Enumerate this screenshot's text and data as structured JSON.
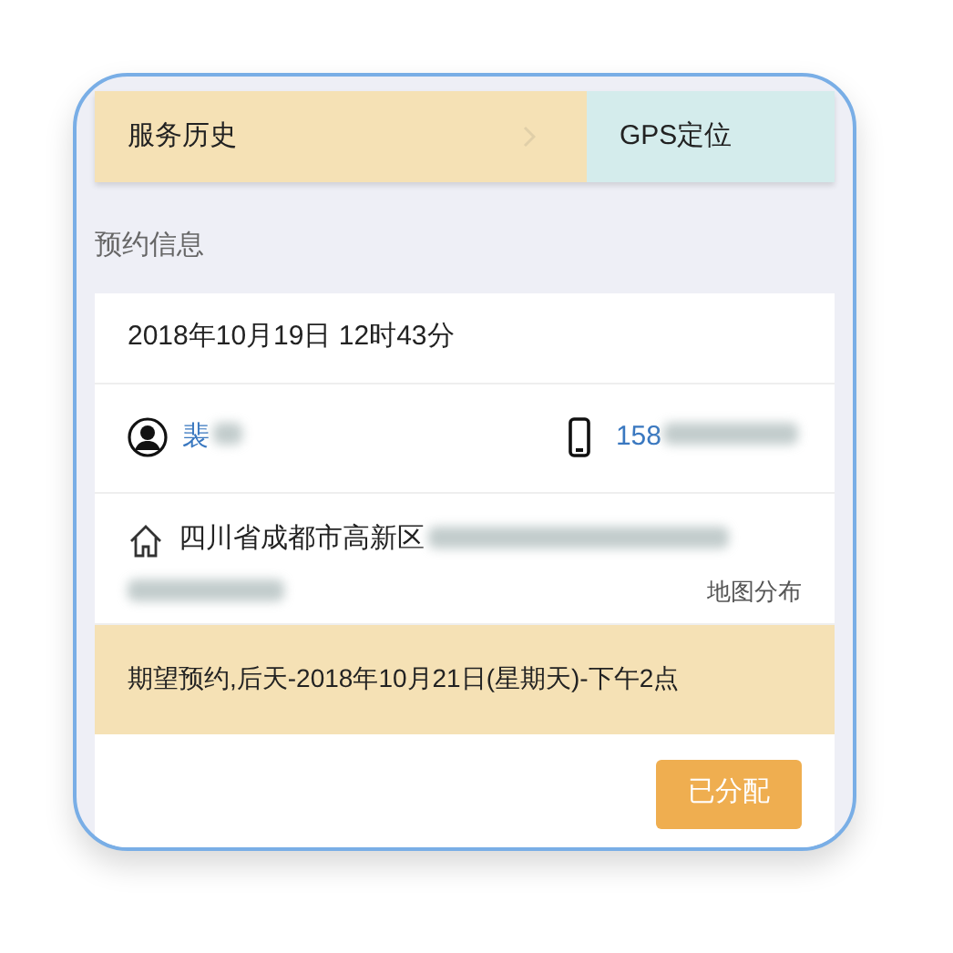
{
  "tabs": [
    {
      "label": "服务历史",
      "color": "#f5e1b5",
      "has_chevron": true
    },
    {
      "label": "GPS定位",
      "color": "#d4ecec",
      "has_chevron": false
    }
  ],
  "section_title": "预约信息",
  "appointment": {
    "datetime": "2018年10月19日 12时43分",
    "contact_name": "裴",
    "phone": "158",
    "address": "四川省成都市高新区",
    "map_link": "地图分布",
    "expected": "期望预约,后天-2018年10月21日(星期天)-下午2点",
    "status_button": "已分配"
  }
}
